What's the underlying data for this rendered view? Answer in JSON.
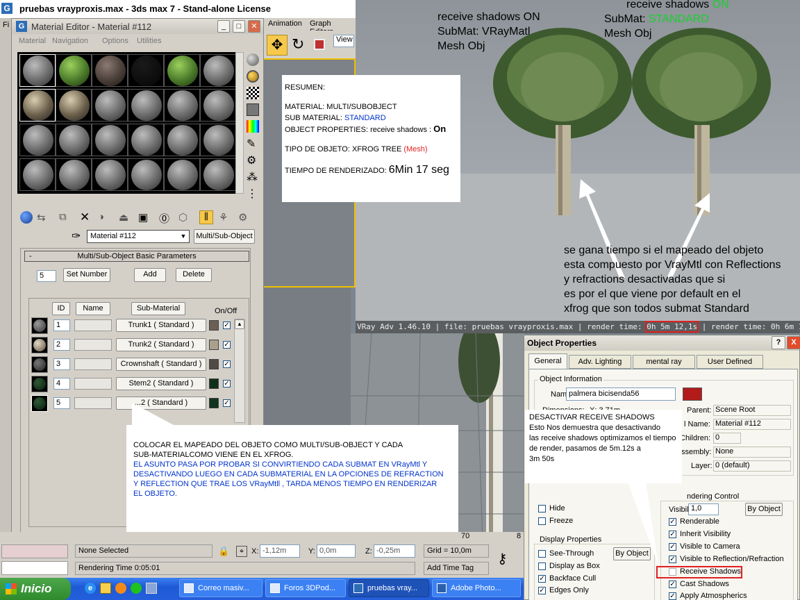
{
  "app_title": "pruebas vrayproxis.max - 3ds max 7  - Stand-alone License",
  "main_menu": {
    "partial": "Fi",
    "animation": "Animation",
    "graph_editors": "Graph Editors",
    "view": "View"
  },
  "mat_editor": {
    "title": "Material Editor - Material #112",
    "menu": [
      "Material",
      "Navigation",
      "Options",
      "Utilities"
    ],
    "material_name": "Material #112",
    "type_button": "Multi/Sub-Object",
    "rollout_title": "Multi/Sub-Object Basic Parameters",
    "rollout_toggle": "-",
    "count": "5",
    "set_number": "Set Number",
    "add": "Add",
    "delete": "Delete",
    "col_id": "ID",
    "col_name": "Name",
    "col_submat": "Sub-Material",
    "col_onoff": "On/Off",
    "rows": [
      {
        "id": "1",
        "submat": "Trunk1  ( Standard )",
        "color": "#6b5f55"
      },
      {
        "id": "2",
        "submat": "Trunk2  ( Standard )",
        "color": "#a9a08e"
      },
      {
        "id": "3",
        "submat": "Crownshaft  ( Standard )",
        "color": "#4f4b44"
      },
      {
        "id": "4",
        "submat": "Stem2  ( Standard )",
        "color": "#10301a"
      },
      {
        "id": "5",
        "submat": "...2  ( Standard )",
        "color": "#11341c"
      }
    ],
    "check": "✓"
  },
  "note_resumen": {
    "l1": "RESUMEN:",
    "l2": "MATERIAL:  MULTI/SUBOBJECT",
    "l3a": "SUB MATERIAL: ",
    "l3b": "STANDARD",
    "l4a": "OBJECT PROPERTIES: receive shadows : ",
    "l4b": "On",
    "l5a": "TIPO DE OBJETO:  XFROG TREE ",
    "l5b": "(Mesh)",
    "l6a": "TIEMPO DE RENDERIZADO: ",
    "l6b": "6Min 17 seg"
  },
  "render_labels": {
    "left1": "receive shadows ON",
    "left2": "SubMat: VRayMatl",
    "left3": "Mesh Obj",
    "right1a": "receive shadows  ",
    "right1b": "ON",
    "right2a": "SubMat: ",
    "right2b": "STANDARD",
    "right3": "Mesh Obj"
  },
  "render_note": [
    "se gana tiempo si el mapeado del objeto",
    "esta compuesto por VrayMtl con Reflections",
    "y refractions desactivadas que si",
    "es por el que viene por default en el",
    "xfrog que son todos submat Standard"
  ],
  "vray_status": {
    "a": "VRay Adv 1.46.10 | file: pruebas vrayproxis.max  | render time: ",
    "b": "0h 5m 12,1s",
    "c": " | render time: 0h 6m 17,9s"
  },
  "note_bottom": {
    "l1": "COLOCAR EL MAPEADO DEL OBJETO COMO MULTI/SUB-OBJECT  Y CADA",
    "l2": "SUB-MATERIALCOMO VIENE EN EL XFROG.",
    "l3": "EL ASUNTO PASA POR PROBAR SI CONVIRTIENDO CADA SUBMAT EN VRayMtl Y",
    "l4": "DESACTIVANDO LUEGO EN CADA SUBMATERIAL  EN LA OPCIONES DE REFRACTION",
    "l5": "Y REFLECTION QUE TRAE LOS VRayMtll , TARDA MENOS TIEMPO EN RENDERIZAR",
    "l6": "EL OBJETO."
  },
  "obj_props": {
    "title": "Object Properties",
    "help": "?",
    "close": "X",
    "tabs": [
      "General",
      "Adv. Lighting",
      "mental ray",
      "User Defined"
    ],
    "info_group": "Object Information",
    "name_label": "Name:",
    "name_value": "palmera bicisenda56",
    "dim_label": "Dimensions:",
    "dim_x": "X: 3,71m",
    "parent_label": "Parent:",
    "parent_value": "Scene Root",
    "matname_label": "l Name:",
    "matname_value": "Material #112",
    "children_label": "Children:",
    "children_value": "0",
    "assembly_label": "ssembly:",
    "assembly_value": "None",
    "layer_label": "Layer:",
    "layer_value": "0 (default)",
    "hide": "Hide",
    "freeze": "Freeze",
    "display_group": "Display Properties",
    "see_through": "See-Through",
    "display_box": "Display as Box",
    "backface": "Backface Cull",
    "edges_only": "Edges Only",
    "by_object": "By Object",
    "render_group": "ndering Control",
    "visibility_label": "Visibility:",
    "visibility_value": "1,0",
    "renderable": "Renderable",
    "inherit": "Inherit Visibility",
    "visible_camera": "Visible to Camera",
    "visible_reflection": "Visible to Reflection/Refraction",
    "receive_shadows": "Receive Shadows",
    "cast_shadows": "Cast Shadows",
    "apply_atmos": "Apply Atmospherics",
    "check": "✓"
  },
  "note_shadows": {
    "l1": "DESACTIVAR RECEIVE SHADOWS",
    "l2": "Esto Nos demuestra que desactivando",
    "l3": "las receive shadows optimizamos el tiempo",
    "l4": "de render, pasamos de  5m.12s a",
    "l5": "3m 50s"
  },
  "status_bar": {
    "selection": "None Selected",
    "x_label": "X:",
    "x_value": "-1,12m",
    "y_label": "Y:",
    "y_value": "0,0m",
    "z_label": "Z:",
    "z_value": "-0,25m",
    "grid": "Grid = 10,0m",
    "render_time": "Rendering Time  0:05:01",
    "add_time_tag": "Add Time Tag",
    "ruler_70": "70",
    "ruler_80": "8"
  },
  "taskbar": {
    "start": "Inicio",
    "tasks": [
      "Correo masiv...",
      "Foros 3DPod...",
      "pruebas vray...",
      "Adobe Photo..."
    ]
  },
  "colors": {
    "xp_blue": "#0a246a",
    "accent_red": "#ff0000",
    "green": "#17d12d",
    "note_blue": "#0033cc"
  }
}
